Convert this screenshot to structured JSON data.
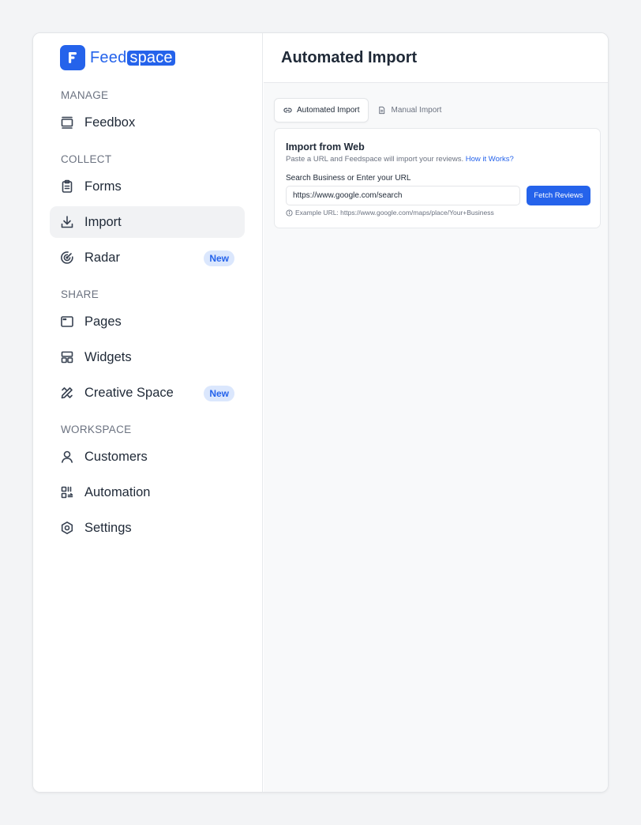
{
  "logo": {
    "word_prefix": "Feed",
    "word_highlight": "space"
  },
  "sidebar": {
    "sections": [
      {
        "label": "MANAGE"
      },
      {
        "label": "COLLECT"
      },
      {
        "label": "SHARE"
      },
      {
        "label": "WORKSPACE"
      }
    ],
    "items": [
      {
        "label": "Feedbox",
        "icon": "inbox-icon"
      },
      {
        "label": "Forms",
        "icon": "clipboard-icon"
      },
      {
        "label": "Import",
        "icon": "download-icon",
        "active": true
      },
      {
        "label": "Radar",
        "icon": "radar-icon",
        "badge": "New"
      },
      {
        "label": "Pages",
        "icon": "browser-window-icon"
      },
      {
        "label": "Widgets",
        "icon": "layout-icon"
      },
      {
        "label": "Creative Space",
        "icon": "pencil-ruler-icon",
        "badge": "New"
      },
      {
        "label": "Customers",
        "icon": "user-icon"
      },
      {
        "label": "Automation",
        "icon": "automation-icon"
      },
      {
        "label": "Settings",
        "icon": "hexagon-settings-icon"
      }
    ]
  },
  "header": {
    "title": "Automated Import"
  },
  "tabs": [
    {
      "label": "Automated Import",
      "icon": "link-icon",
      "active": true
    },
    {
      "label": "Manual Import",
      "icon": "file-icon",
      "active": false
    }
  ],
  "card": {
    "title": "Import from Web",
    "description": "Paste a URL and Feedspace will import your reviews.",
    "help_link": "How it Works?",
    "field_label": "Search Business or Enter your URL",
    "url_value": "https://www.google.com/search",
    "fetch_button": "Fetch Reviews",
    "example_hint": "Example URL: https://www.google.com/maps/place/Your+Business"
  },
  "colors": {
    "accent": "#2563eb",
    "badge_bg": "#dbe7fd",
    "active_nav_bg": "#f1f2f4"
  }
}
